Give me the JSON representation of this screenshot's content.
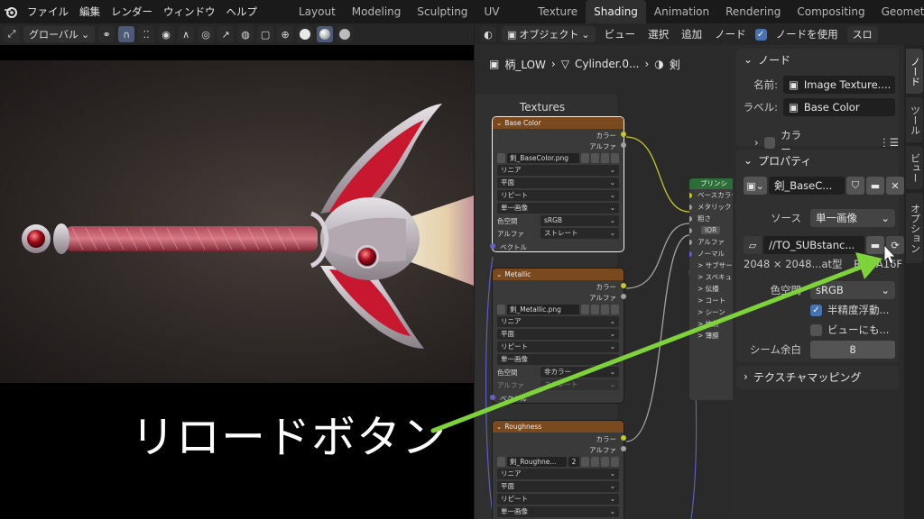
{
  "menubar": {
    "items": [
      "ファイル",
      "編集",
      "レンダー",
      "ウィンドウ",
      "ヘルプ"
    ],
    "workspaces": [
      "Layout",
      "Modeling",
      "Sculpting",
      "UV Editing",
      "Texture Paint",
      "Shading",
      "Animation",
      "Rendering",
      "Compositing",
      "Geometry"
    ],
    "active_workspace": "Shading"
  },
  "viewport_header": {
    "transform": "グローバル"
  },
  "node_header": {
    "object_mode": "オブジェクト",
    "menus": [
      "ビュー",
      "選択",
      "追加",
      "ノード"
    ],
    "use_nodes": "ノードを使用",
    "slot": "スロ"
  },
  "breadcrumb": {
    "object": "柄_LOW",
    "mesh": "Cylinder.0...",
    "material": "剣"
  },
  "frame": {
    "label": "Textures"
  },
  "nodes": [
    {
      "title": "Base Color",
      "outputs": [
        "カラー",
        "アルファ"
      ],
      "image": "剣_BaseColor.png",
      "options": [
        "リニア",
        "平面",
        "リピート",
        "単一画像"
      ],
      "colorspace_label": "色空間",
      "colorspace": "sRGB",
      "alpha_label": "アルファ",
      "alpha": "ストレート",
      "input": "ベクトル"
    },
    {
      "title": "Metallic",
      "outputs": [
        "カラー",
        "アルファ"
      ],
      "image": "剣_Metallic.png",
      "options": [
        "リニア",
        "平面",
        "リピート",
        "単一画像"
      ],
      "colorspace_label": "色空間",
      "colorspace": "非カラー",
      "alpha_label": "アルファ",
      "alpha": "ストレート",
      "input": "ベクトル"
    },
    {
      "title": "Roughness",
      "outputs": [
        "カラー",
        "アルファ"
      ],
      "image": "剣_Roughne...",
      "users": "2",
      "options": [
        "リニア",
        "平面",
        "リピート",
        "単一画像"
      ]
    }
  ],
  "bsdf": {
    "title": "プリンシ",
    "rows": [
      "ベースカラー",
      "メタリック",
      "粗さ",
      "IOR",
      "アルファ",
      "ノーマル",
      "> サブサー",
      "> スペキュ",
      "> 伝播",
      "> コート",
      "> シーン",
      "> 放射",
      "> 薄膜"
    ]
  },
  "sidebar": {
    "node_panel": {
      "title": "ノード",
      "name_label": "名前:",
      "name": "Image Texture....",
      "label_label": "ラベル:",
      "label": "Base Color",
      "color_sub": "カラー"
    },
    "props_panel": {
      "title": "プロパティ",
      "image_name": "剣_BaseC...",
      "source_label": "ソース",
      "source": "単一画像",
      "filepath": "//TO_SUBstanc...",
      "info": "2048 × 2048...at型",
      "info_right": "RGBA16F",
      "colorspace_label": "色空間",
      "colorspace": "sRGB",
      "half_float": "半精度浮動...",
      "view_as": "ビューにも...",
      "seam_label": "シーム余白",
      "seam": "8"
    },
    "mapping_panel": {
      "title": "テクスチャマッピング"
    }
  },
  "side_tabs": [
    "ノード",
    "ツール",
    "ビュー",
    "オプション"
  ],
  "annotation": {
    "text": "リロードボタン"
  },
  "colors": {
    "accent": "#4772b3",
    "arrow": "#7ed23a",
    "image_node_header": "#7a4a1e",
    "shader_node_header": "#2d6d3a"
  },
  "icons": [
    "blender-logo",
    "image-icon",
    "folder-icon",
    "reload-icon",
    "close-icon",
    "shield-icon",
    "mesh-icon",
    "material-icon",
    "object-icon",
    "cursor-icon"
  ]
}
